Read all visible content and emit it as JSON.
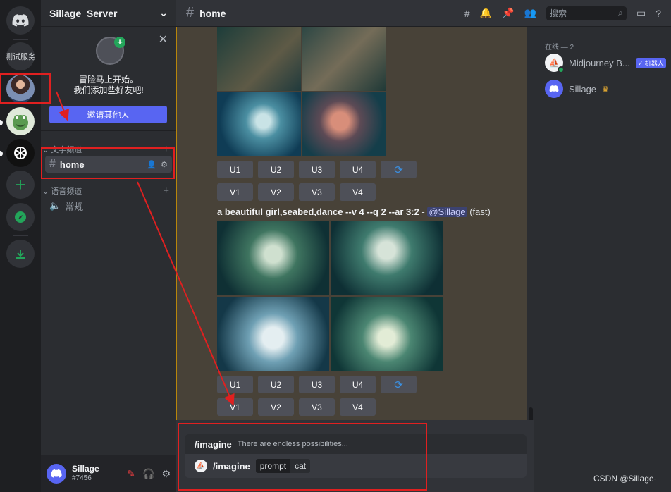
{
  "rail": {
    "test_server_label": "测试服务"
  },
  "guild": {
    "name": "Sillage_Server"
  },
  "invite": {
    "line1": "冒险马上开始。",
    "line2": "我们添加些好友吧!",
    "button": "邀请其他人"
  },
  "categories": {
    "text": "文字频道",
    "voice": "语音频道"
  },
  "channels": {
    "text_channel": "home",
    "voice_channel": "常规"
  },
  "user": {
    "name": "Sillage",
    "tag": "#7456"
  },
  "header": {
    "channel_title": "home",
    "search_placeholder": "搜索"
  },
  "messages": {
    "upscale_buttons": [
      "U1",
      "U2",
      "U3",
      "U4"
    ],
    "variation_buttons": [
      "V1",
      "V2",
      "V3",
      "V4"
    ],
    "prompt_text": "a beautiful girl,seabed,dance --v 4 --q 2 --ar 3:2",
    "separator": " - ",
    "mention": "@Sillage",
    "mode": " (fast)"
  },
  "composer": {
    "command": "/imagine",
    "hint": "There are endless possibilities...",
    "option_name": "prompt",
    "option_value": "cat"
  },
  "members": {
    "online_header": "在线 — 2",
    "list": [
      {
        "name": "Midjourney B...",
        "badge": "✓ 机器人"
      },
      {
        "name": "Sillage"
      }
    ]
  },
  "watermark": "CSDN @Sillage·",
  "colors": {
    "accent": "#5865f2",
    "annotation": "#e02020",
    "online": "#23a55a"
  }
}
